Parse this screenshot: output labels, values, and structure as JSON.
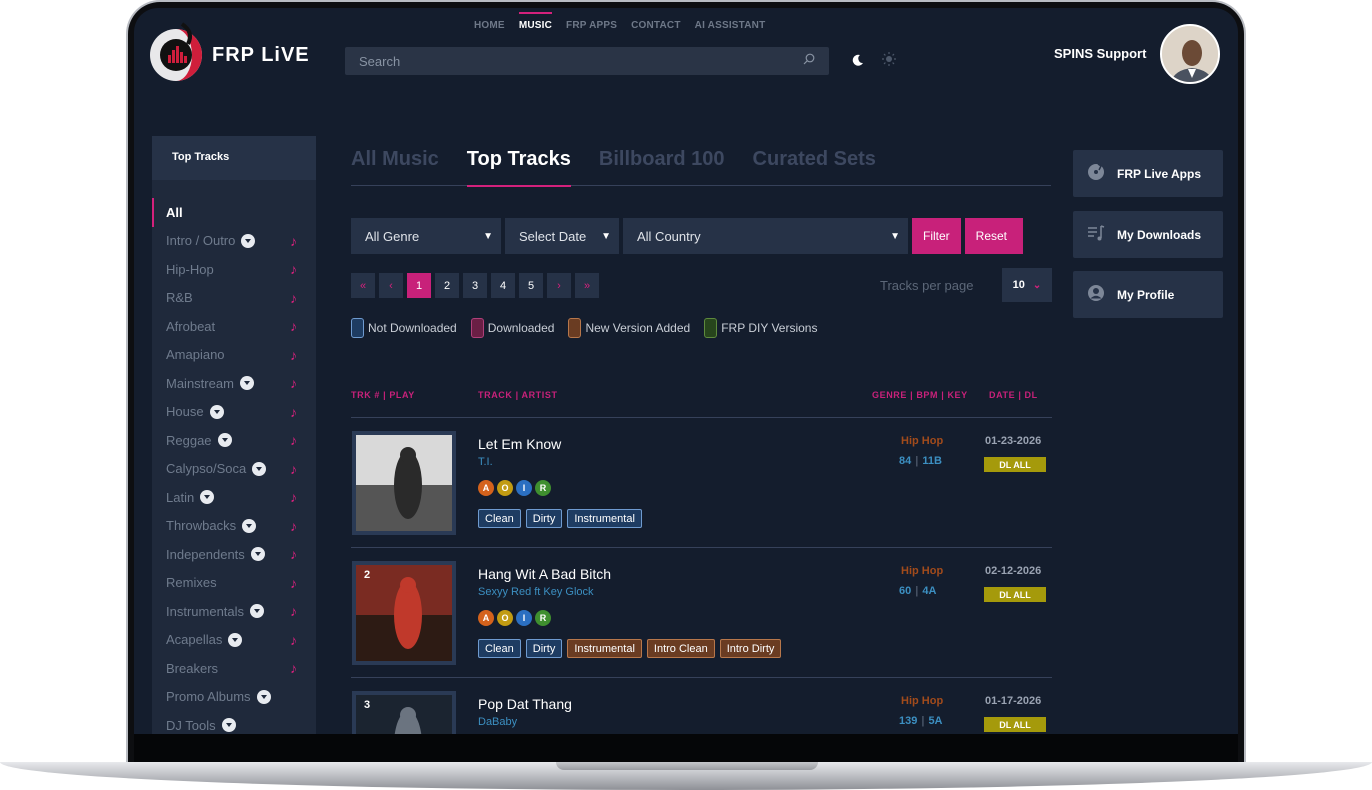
{
  "app": {
    "logo_text": "FRP LiVE"
  },
  "topnav": [
    {
      "label": "HOME",
      "active": false
    },
    {
      "label": "MUSIC",
      "active": true
    },
    {
      "label": "FRP APPS",
      "active": false
    },
    {
      "label": "CONTACT",
      "active": false
    },
    {
      "label": "AI ASSISTANT",
      "active": false
    }
  ],
  "search": {
    "placeholder": "Search"
  },
  "user": {
    "name": "SPINS Support"
  },
  "sidebar": {
    "title": "Top Tracks",
    "items": [
      {
        "label": "All",
        "active": true,
        "dropdown": false,
        "note": false
      },
      {
        "label": "Intro / Outro",
        "dropdown": true,
        "note": true
      },
      {
        "label": "Hip-Hop",
        "dropdown": false,
        "note": true
      },
      {
        "label": "R&B",
        "dropdown": false,
        "note": true
      },
      {
        "label": "Afrobeat",
        "dropdown": false,
        "note": true
      },
      {
        "label": "Amapiano",
        "dropdown": false,
        "note": true
      },
      {
        "label": "Mainstream",
        "dropdown": true,
        "note": true
      },
      {
        "label": "House",
        "dropdown": true,
        "note": true
      },
      {
        "label": "Reggae",
        "dropdown": true,
        "note": true
      },
      {
        "label": "Calypso/Soca",
        "dropdown": true,
        "note": true
      },
      {
        "label": "Latin",
        "dropdown": true,
        "note": true
      },
      {
        "label": "Throwbacks",
        "dropdown": true,
        "note": true
      },
      {
        "label": "Independents",
        "dropdown": true,
        "note": true
      },
      {
        "label": "Remixes",
        "dropdown": false,
        "note": true
      },
      {
        "label": "Instrumentals",
        "dropdown": true,
        "note": true
      },
      {
        "label": "Acapellas",
        "dropdown": true,
        "note": true
      },
      {
        "label": "Breakers",
        "dropdown": false,
        "note": true
      },
      {
        "label": "Promo Albums",
        "dropdown": true,
        "note": false
      },
      {
        "label": "DJ Tools",
        "dropdown": true,
        "note": false
      }
    ]
  },
  "tabs": [
    {
      "label": "All Music",
      "active": false
    },
    {
      "label": "Top Tracks",
      "active": true
    },
    {
      "label": "Billboard 100",
      "active": false
    },
    {
      "label": "Curated Sets",
      "active": false
    }
  ],
  "filters": {
    "genre": "All Genre",
    "date": "Select Date",
    "country": "All Country",
    "filter_label": "Filter",
    "reset_label": "Reset"
  },
  "pagination": {
    "first": "«",
    "prev": "‹",
    "pages": [
      "1",
      "2",
      "3",
      "4",
      "5"
    ],
    "current": "1",
    "next": "›",
    "last": "»",
    "tracks_per_page_label": "Tracks per page",
    "tracks_per_page": "10"
  },
  "legend": [
    {
      "label": "Not Downloaded",
      "color": "#1e3c62",
      "border": "#6f9bd0"
    },
    {
      "label": "Downloaded",
      "color": "#6a1f45",
      "border": "#b0407a"
    },
    {
      "label": "New Version Added",
      "color": "#6a3c22",
      "border": "#b7774b"
    },
    {
      "label": "FRP DIY Versions",
      "color": "#27451c",
      "border": "#5e8a3d"
    }
  ],
  "columns": {
    "trk": "TRK # | PLAY",
    "track": "TRACK | ARTIST",
    "genre": "GENRE | BPM | KEY",
    "date": "DATE | DL"
  },
  "badge_colors": {
    "A": "#d4621c",
    "O": "#c19b12",
    "I": "#2b6fc1",
    "R": "#3f8f2f"
  },
  "tracks": [
    {
      "num": "",
      "title": "Let Em Know",
      "artist": "T.I.",
      "badges": [
        "A",
        "O",
        "I",
        "R"
      ],
      "versions": [
        {
          "label": "Clean",
          "new": false
        },
        {
          "label": "Dirty",
          "new": false
        },
        {
          "label": "Instrumental",
          "new": false
        }
      ],
      "genre": "Hip Hop",
      "bpm": "84",
      "key": "11B",
      "date": "01-23-2026",
      "dl": "DL ALL"
    },
    {
      "num": "2",
      "title": "Hang Wit A Bad Bitch",
      "artist": "Sexyy Red ft Key Glock",
      "badges": [
        "A",
        "O",
        "I",
        "R"
      ],
      "versions": [
        {
          "label": "Clean",
          "new": false
        },
        {
          "label": "Dirty",
          "new": false
        },
        {
          "label": "Instrumental",
          "new": true
        },
        {
          "label": "Intro Clean",
          "new": true
        },
        {
          "label": "Intro Dirty",
          "new": true
        }
      ],
      "genre": "Hip Hop",
      "bpm": "60",
      "key": "4A",
      "date": "02-12-2026",
      "dl": "DL ALL"
    },
    {
      "num": "3",
      "title": "Pop Dat Thang",
      "artist": "DaBaby",
      "badges": [],
      "versions": [],
      "genre": "Hip Hop",
      "bpm": "139",
      "key": "5A",
      "date": "01-17-2026",
      "dl": "DL ALL"
    }
  ],
  "right_panel": [
    {
      "label": "FRP Live Apps",
      "icon": "disc-icon"
    },
    {
      "label": "My Downloads",
      "icon": "playlist-icon"
    },
    {
      "label": "My Profile",
      "icon": "user-icon"
    }
  ]
}
